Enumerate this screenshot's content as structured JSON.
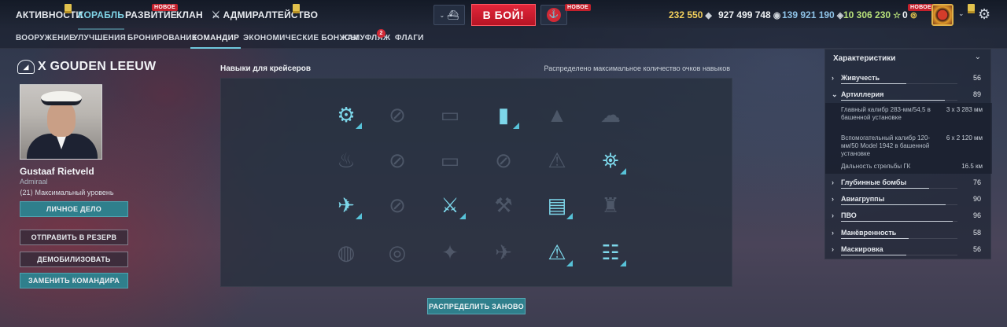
{
  "topnav": {
    "items": [
      {
        "label": "АКТИВНОСТИ"
      },
      {
        "label": "КОРАБЛЬ"
      },
      {
        "label": "РАЗВИТИЕ"
      },
      {
        "label": "КЛАН"
      },
      {
        "label": "АДМИРАЛТЕЙСТВО"
      }
    ],
    "new_badge": "НОВОЕ",
    "battle_button": "В БОЙ!",
    "currencies": {
      "credits": "232 550",
      "silver": "927 499 748",
      "free_xp": "139 921 190",
      "elite_xp": "10 306 230",
      "premium": "0"
    },
    "premium_new_badge": "НОВОЕ"
  },
  "subnav": {
    "items": [
      {
        "label": "ВООРУЖЕНИЕ"
      },
      {
        "label": "УЛУЧШЕНИЯ"
      },
      {
        "label": "БРОНИРОВАНИЕ"
      },
      {
        "label": "КОМАНДИР"
      },
      {
        "label": "ЭКОНОМИЧЕСКИЕ БОНУСЫ"
      },
      {
        "label": "КАМУФЛЯЖ"
      },
      {
        "label": "ФЛАГИ"
      }
    ],
    "camo_count": "2"
  },
  "ship": {
    "tier_name": "X GOUDEN LEEUW"
  },
  "commander": {
    "name": "Gustaaf Rietveld",
    "rank": "Admiraal",
    "level": "⟨21⟩ Максимальный уровень",
    "personal_file_button": "ЛИЧНОЕ ДЕЛО",
    "reserve_button": "ОТПРАВИТЬ В РЕЗЕРВ",
    "demobilize_button": "ДЕМОБИЛИЗОВАТЬ",
    "replace_button": "ЗАМЕНИТЬ КОМАНДИРА"
  },
  "skills": {
    "title": "Навыки для крейсеров",
    "note": "Распределено максимальное количество очков навыков",
    "redistribute_button": "РАСПРЕДЕЛИТЬ ЗАНОВО",
    "grid": [
      [
        {
          "icon": "gunner-icon",
          "on": true
        },
        {
          "icon": "locked-icon",
          "on": false
        },
        {
          "icon": "torpedo-icon",
          "on": false
        },
        {
          "icon": "shells-icon",
          "on": true
        },
        {
          "icon": "shell-icon",
          "on": false
        },
        {
          "icon": "smoke-icon",
          "on": false
        }
      ],
      [
        {
          "icon": "fire-icon",
          "on": false
        },
        {
          "icon": "locked-icon",
          "on": false
        },
        {
          "icon": "torpedo-icon",
          "on": false
        },
        {
          "icon": "locked-icon",
          "on": false
        },
        {
          "icon": "warning-icon",
          "on": false
        },
        {
          "icon": "turret-icon",
          "on": true
        }
      ],
      [
        {
          "icon": "aa-plane-icon",
          "on": true
        },
        {
          "icon": "locked-icon",
          "on": false
        },
        {
          "icon": "crossed-swords-icon",
          "on": true
        },
        {
          "icon": "repair-icon",
          "on": false
        },
        {
          "icon": "armor-icon",
          "on": true
        },
        {
          "icon": "tower-icon",
          "on": false
        }
      ],
      [
        {
          "icon": "flood-icon",
          "on": false
        },
        {
          "icon": "radar-icon",
          "on": false
        },
        {
          "icon": "bird-icon",
          "on": false
        },
        {
          "icon": "plane-icon",
          "on": false
        },
        {
          "icon": "alert-icon",
          "on": true
        },
        {
          "icon": "radio-icon",
          "on": true
        }
      ]
    ]
  },
  "stats": {
    "header": "Характеристики",
    "rows": [
      {
        "label": "Живучесть",
        "value": "56",
        "fraction": 0.56
      },
      {
        "label": "Артиллерия",
        "value": "89",
        "fraction": 0.89
      }
    ],
    "artillery_details": [
      {
        "label": "Главный калибр 283-мм/54,5 в башенной установке",
        "value": "3 х 3  283 мм"
      },
      {
        "label": "Вспомогательный калибр 120-мм/50 Model 1942 в башенной установке",
        "value": "6 х 2  120 мм"
      },
      {
        "label": "Дальность стрельбы ГК",
        "value": "16.5 км"
      }
    ],
    "rows_after": [
      {
        "label": "Глубинные бомбы",
        "value": "76",
        "fraction": 0.76
      },
      {
        "label": "Авиагруппы",
        "value": "90",
        "fraction": 0.9
      },
      {
        "label": "ПВО",
        "value": "96",
        "fraction": 0.96
      },
      {
        "label": "Манёвренность",
        "value": "58",
        "fraction": 0.58
      },
      {
        "label": "Маскировка",
        "value": "56",
        "fraction": 0.56
      }
    ]
  },
  "colors": {
    "accent": "#7fd3e6",
    "battle": "#d41e30",
    "teal_button": "#2f7f8c"
  }
}
